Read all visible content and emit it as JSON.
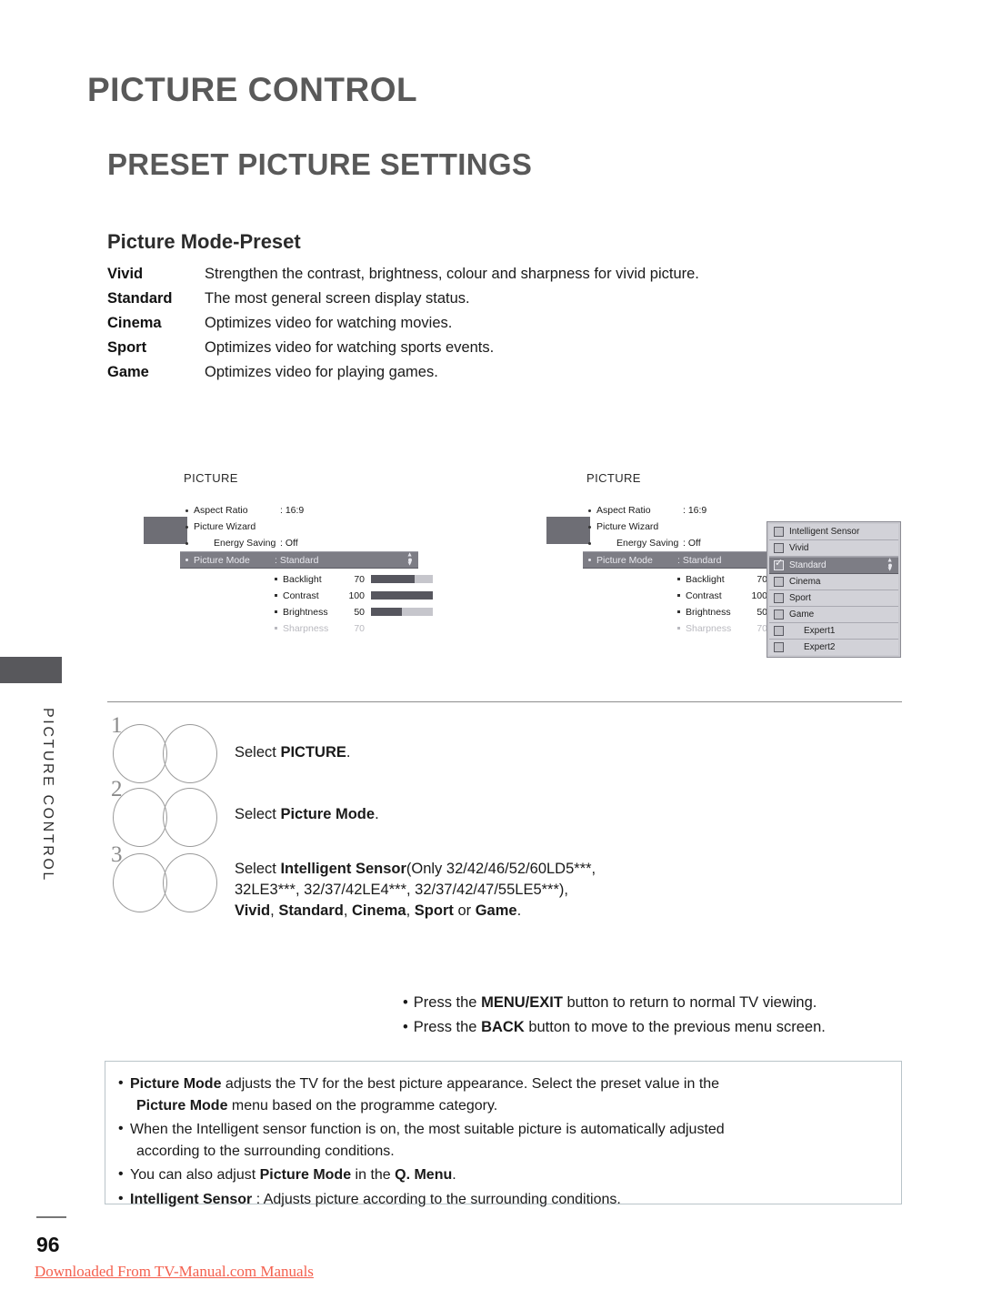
{
  "headings": {
    "chapter": "PICTURE CONTROL",
    "section": "PRESET PICTURE SETTINGS",
    "subsection": "Picture Mode-Preset"
  },
  "definitions": [
    {
      "term": "Vivid",
      "desc": "Strengthen the contrast, brightness, colour and sharpness for vivid picture."
    },
    {
      "term": "Standard",
      "desc": "The most general screen display status."
    },
    {
      "term": "Cinema",
      "desc": "Optimizes video for watching movies."
    },
    {
      "term": "Sport",
      "desc": "Optimizes video for watching sports events."
    },
    {
      "term": "Game",
      "desc": "Optimizes video for playing games."
    }
  ],
  "osd": {
    "title": "PICTURE",
    "rows": [
      {
        "label": "Aspect Ratio",
        "value": ": 16:9"
      },
      {
        "label": "Picture Wizard",
        "value": ""
      },
      {
        "label": "Energy Saving",
        "value": ": Off"
      }
    ],
    "highlight": {
      "label": "Picture Mode",
      "value": ": Standard"
    },
    "sliders": [
      {
        "name": "Backlight",
        "value": "70",
        "pct": 70,
        "dim": false
      },
      {
        "name": "Contrast",
        "value": "100",
        "pct": 100,
        "dim": false
      },
      {
        "name": "Brightness",
        "value": "50",
        "pct": 50,
        "dim": false
      },
      {
        "name": "Sharpness",
        "value": "70",
        "pct": 0,
        "dim": true
      }
    ]
  },
  "dropdown": {
    "items": [
      {
        "label": "Intelligent Sensor",
        "checked": false,
        "selected": false,
        "indent": false
      },
      {
        "label": "Vivid",
        "checked": false,
        "selected": false,
        "indent": false
      },
      {
        "label": "Standard",
        "checked": true,
        "selected": true,
        "indent": false
      },
      {
        "label": "Cinema",
        "checked": false,
        "selected": false,
        "indent": false
      },
      {
        "label": "Sport",
        "checked": false,
        "selected": false,
        "indent": false
      },
      {
        "label": "Game",
        "checked": false,
        "selected": false,
        "indent": false
      },
      {
        "label": "Expert1",
        "checked": false,
        "selected": false,
        "indent": true
      },
      {
        "label": "Expert2",
        "checked": false,
        "selected": false,
        "indent": true
      }
    ]
  },
  "side_tab": {
    "label": "PICTURE CONTROL"
  },
  "steps": [
    {
      "number": "1",
      "text_html": "Select <b>PICTURE</b>."
    },
    {
      "number": "2",
      "text_html": "Select <b>Picture Mode</b>."
    },
    {
      "number": "3",
      "text_html": "Select <b>Intelligent Sensor</b>(Only 32/42/46/52/60LD5***,<br>32LE3***, 32/37/42LE4***, 32/37/42/47/55LE5***),<br><b>Vivid</b>, <b>Standard</b>, <b>Cinema</b>, <b>Sport</b> or <b>Game</b>."
    }
  ],
  "notes": [
    "Press the <b>MENU/EXIT</b> button to return to normal TV viewing.",
    "Press the <b>BACK</b> button to move to the previous menu screen."
  ],
  "infobox": [
    "<b>Picture Mode</b> adjusts the TV for the best picture appearance. Select the preset value in the<span class=\"ind\"><b>Picture Mode</b> menu based on the programme category.</span>",
    "When the Intelligent sensor function is on, the most suitable picture is automatically adjusted<span class=\"ind\">according to the surrounding conditions.</span>",
    "You can also adjust <b>Picture Mode</b> in the <b>Q. Menu</b>.",
    "<b>Intelligent Sensor</b> : Adjusts picture according to the surrounding conditions."
  ],
  "footer": {
    "page_number": "96",
    "download_text": "Downloaded From TV-Manual.com Manuals"
  },
  "colors": {
    "heading_gray": "#595959",
    "osd_highlight": "#7d7d85",
    "osd_slider_fill": "#56565e",
    "osd_slider_track": "#c6c6cc",
    "dropdown_bg": "#d2d2d8",
    "link_red": "#f4604e"
  }
}
